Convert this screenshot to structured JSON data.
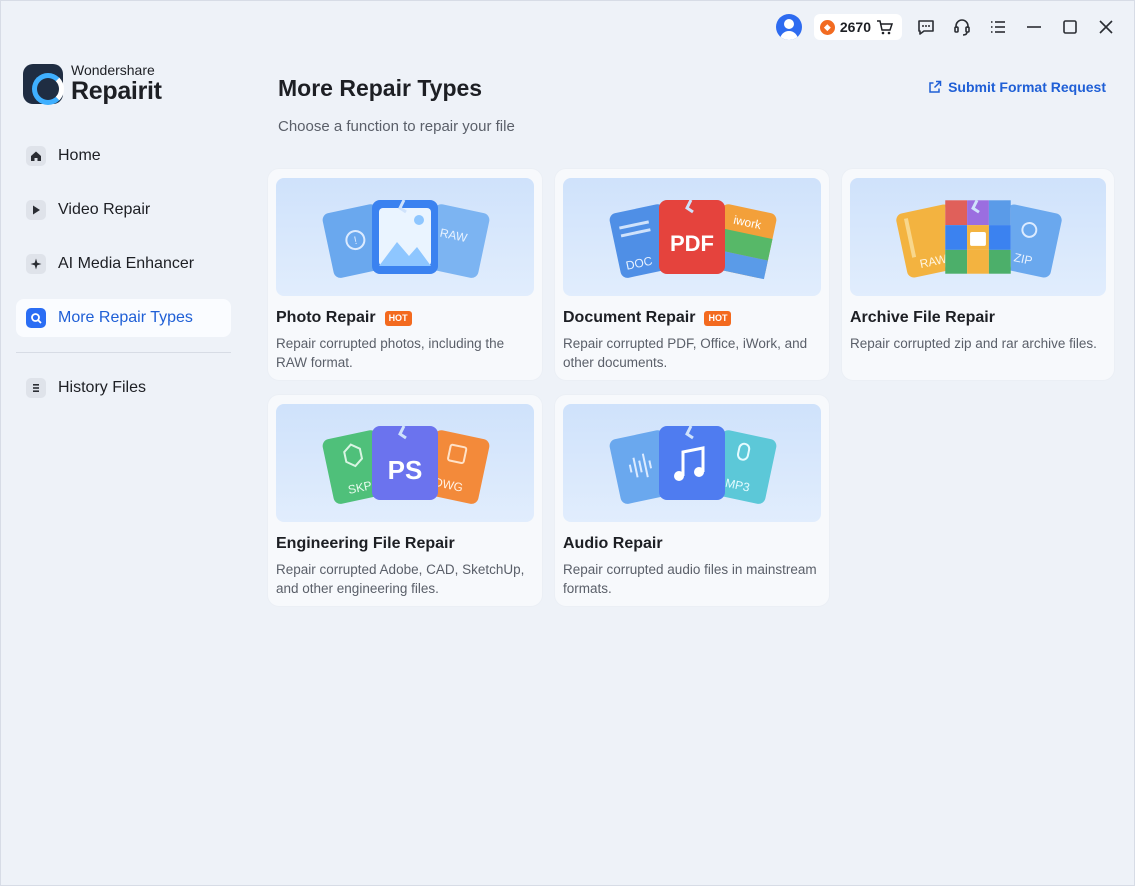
{
  "app": {
    "brand_sub": "Wondershare",
    "brand_main": "Repairit"
  },
  "titlebar": {
    "credits": "2670"
  },
  "sidebar": {
    "items": [
      {
        "label": "Home",
        "icon": "home-icon"
      },
      {
        "label": "Video Repair",
        "icon": "play-icon"
      },
      {
        "label": "AI Media Enhancer",
        "icon": "sparkle-icon"
      },
      {
        "label": "More Repair Types",
        "icon": "wrench-icon",
        "active": true
      },
      {
        "label": "History Files",
        "icon": "list-icon"
      }
    ]
  },
  "main": {
    "title": "More Repair Types",
    "subtitle": "Choose a function to repair your file",
    "submit_label": "Submit Format Request",
    "cards": [
      {
        "title": "Photo Repair",
        "badge": "HOT",
        "desc": "Repair corrupted photos, including the RAW format.",
        "art": {
          "left": "",
          "right": "RAW",
          "center": ""
        }
      },
      {
        "title": "Document Repair",
        "badge": "HOT",
        "desc": "Repair corrupted PDF, Office, iWork, and other documents.",
        "art": {
          "left": "DOC",
          "right": "iwork",
          "center": "PDF"
        }
      },
      {
        "title": "Archive File Repair",
        "badge": "",
        "desc": "Repair corrupted zip and rar archive files.",
        "art": {
          "left": "RAW",
          "right": "ZIP",
          "center": ""
        }
      },
      {
        "title": "Engineering File Repair",
        "badge": "",
        "desc": "Repair corrupted Adobe, CAD, SketchUp, and other engineering files.",
        "art": {
          "left": "SKP",
          "right": "DWG",
          "center": "PS"
        }
      },
      {
        "title": "Audio Repair",
        "badge": "",
        "desc": "Repair corrupted audio files in mainstream formats.",
        "art": {
          "left": "",
          "right": "MP3",
          "center": ""
        }
      }
    ]
  },
  "colors": {
    "accent": "#1f5fd6",
    "hot": "#f36a1f",
    "background": "#eef2f8"
  }
}
